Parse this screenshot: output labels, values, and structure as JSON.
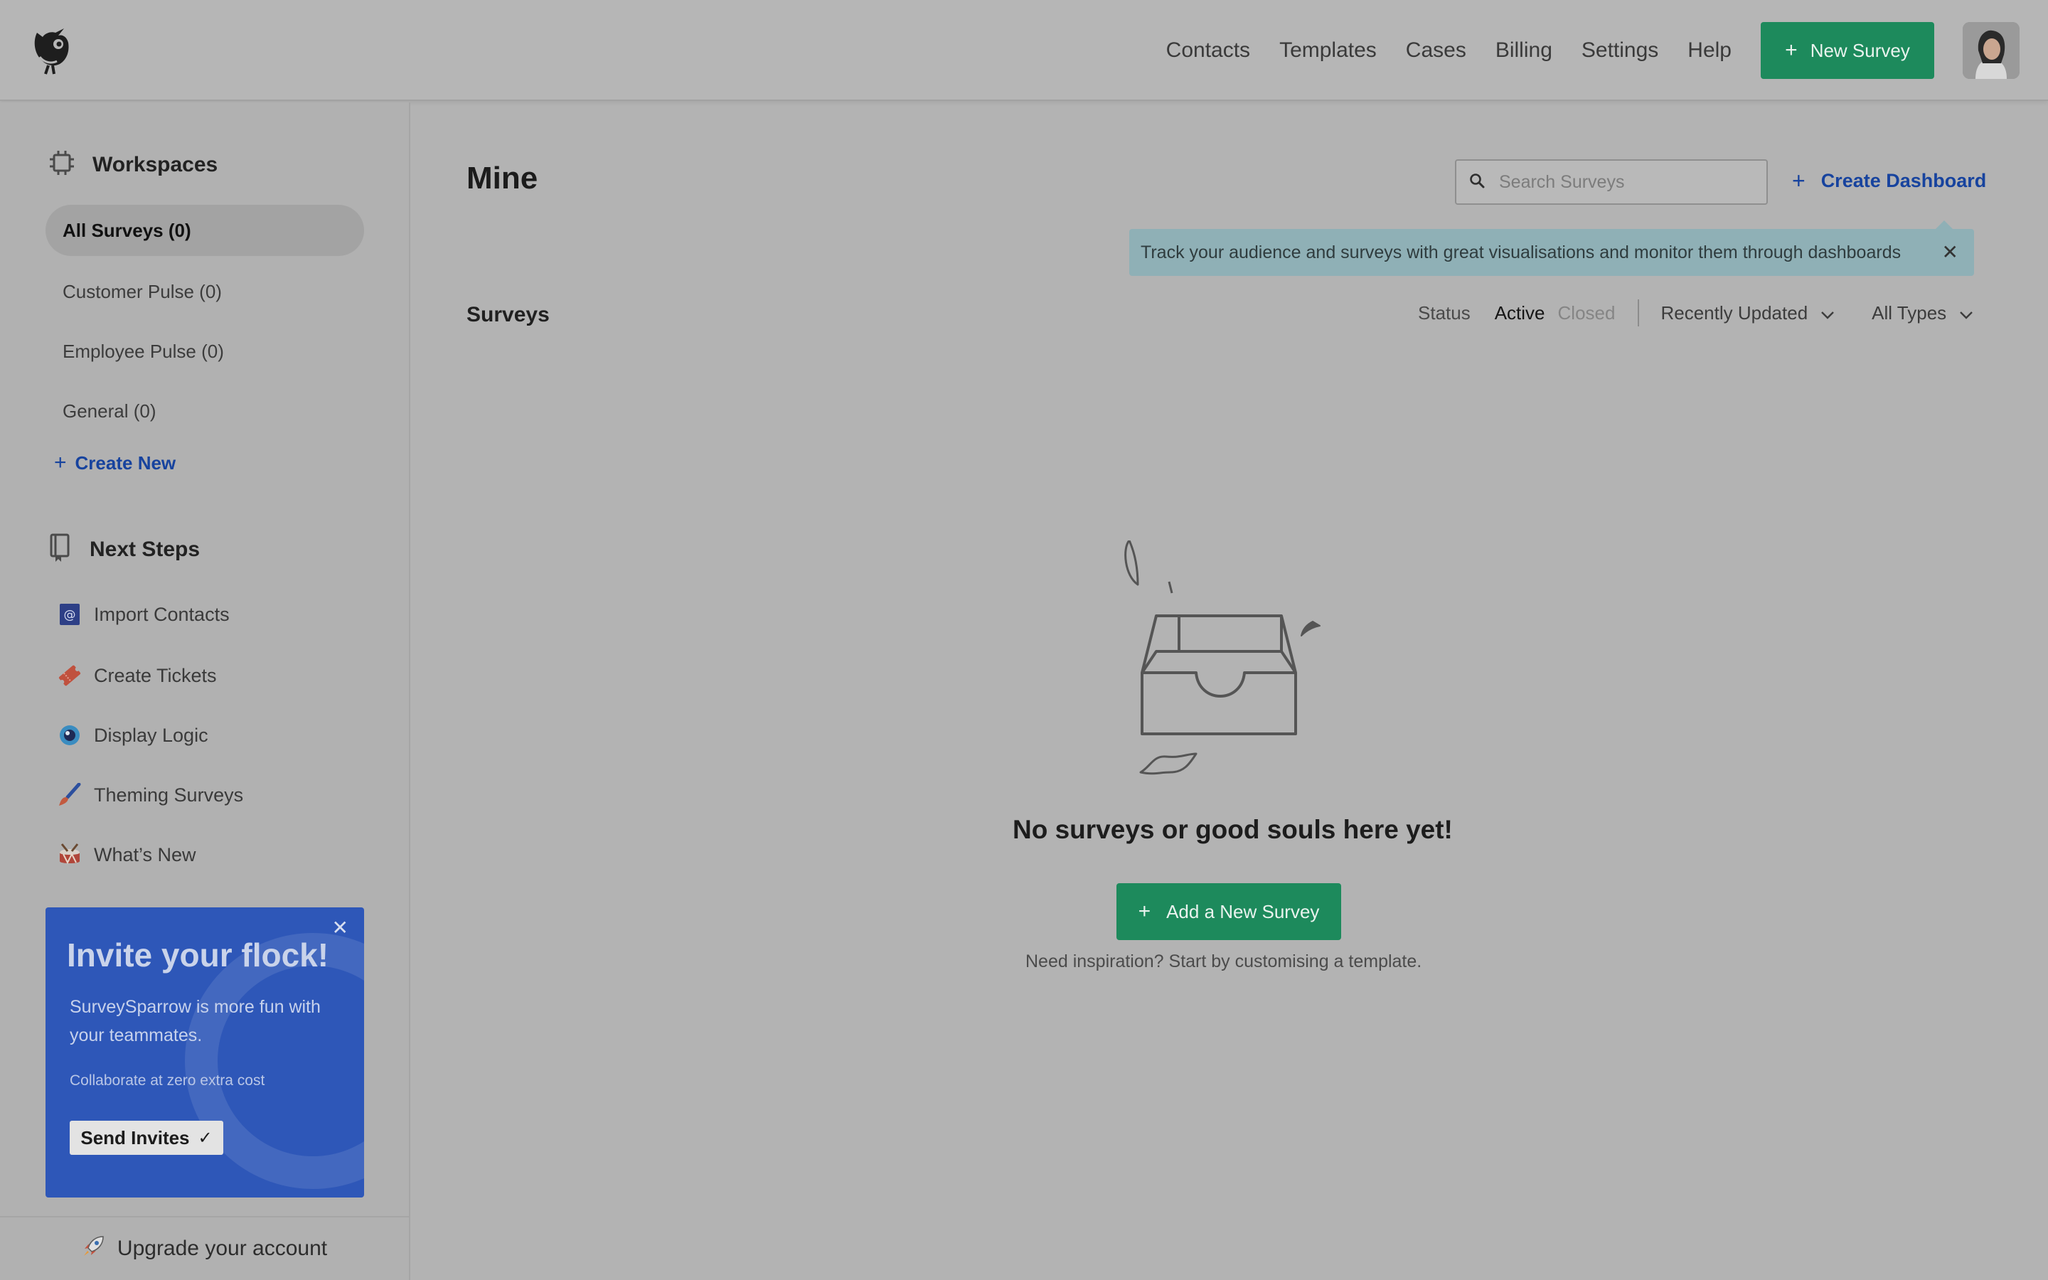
{
  "header": {
    "nav": [
      "Contacts",
      "Templates",
      "Cases",
      "Billing",
      "Settings",
      "Help"
    ],
    "new_survey_label": "New Survey"
  },
  "sidebar": {
    "workspaces_title": "Workspaces",
    "workspaces": [
      {
        "label": "All Surveys (0)",
        "active": true
      },
      {
        "label": "Customer Pulse (0)",
        "active": false
      },
      {
        "label": "Employee Pulse (0)",
        "active": false
      },
      {
        "label": "General (0)",
        "active": false
      }
    ],
    "create_new_label": "Create New",
    "next_steps_title": "Next Steps",
    "next_steps": [
      {
        "label": "Import Contacts",
        "icon": "at-sign-icon"
      },
      {
        "label": "Create Tickets",
        "icon": "ticket-icon"
      },
      {
        "label": "Display Logic",
        "icon": "eye-icon"
      },
      {
        "label": "Theming Surveys",
        "icon": "paintbrush-icon"
      },
      {
        "label": "What’s New",
        "icon": "drum-icon"
      }
    ],
    "invite": {
      "title": "Invite your flock!",
      "subtitle": "SurveySparrow is more fun with your teammates.",
      "small_text": "Collaborate at zero extra cost",
      "button_label": "Send Invites"
    },
    "upgrade_label": "Upgrade your account"
  },
  "main": {
    "title": "Mine",
    "search_placeholder": "Search Surveys",
    "create_dashboard_label": "Create Dashboard",
    "tip_text": "Track your audience and  surveys with great visualisations and monitor them through dashboards",
    "surveys_label": "Surveys",
    "filters": {
      "status_label": "Status",
      "active_label": "Active",
      "closed_label": "Closed",
      "sort_label": "Recently Updated",
      "type_label": "All Types"
    },
    "empty": {
      "title": "No surveys or good souls here yet!",
      "button_label": "Add a New Survey",
      "hint": "Need inspiration? Start by customising a template."
    }
  },
  "colors": {
    "primary_green": "#1d8a5c",
    "link_blue": "#17439e",
    "invite_blue": "#2e57b8",
    "tip_bg": "#8fb0b6"
  }
}
